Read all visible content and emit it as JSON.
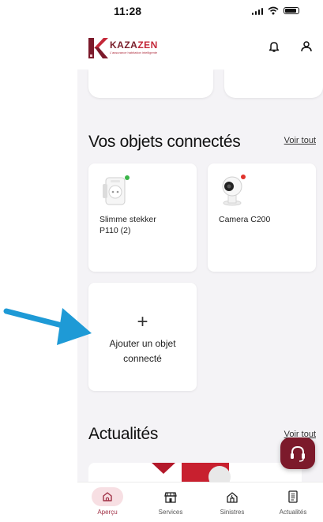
{
  "status": {
    "time": "11:28"
  },
  "brand": {
    "name_part1": "KAZA",
    "name_part2": "ZEN",
    "tagline": "L'assurance habitation intelligente",
    "accent": "#7c1a2b",
    "accent_light": "#c42839"
  },
  "header": {
    "icons": [
      "bell-icon",
      "user-icon"
    ]
  },
  "connected": {
    "title": "Vos objets connectés",
    "see_all": "Voir tout",
    "devices": [
      {
        "name_line1": "Slimme stekker",
        "name_line2": "P110 (2)",
        "status": "online",
        "status_color": "#3bb54a"
      },
      {
        "name_line1": "Camera C200",
        "status": "offline",
        "status_color": "#e0322c"
      }
    ],
    "add": {
      "line1": "Ajouter un objet",
      "line2": "connecté"
    }
  },
  "news": {
    "title": "Actualités",
    "see_all": "Voir tout"
  },
  "tabs": [
    {
      "label": "Aperçu",
      "icon": "home-icon",
      "active": true
    },
    {
      "label": "Services",
      "icon": "store-icon",
      "active": false
    },
    {
      "label": "Sinistres",
      "icon": "house-damage-icon",
      "active": false
    },
    {
      "label": "Actualités",
      "icon": "newspaper-icon",
      "active": false
    }
  ],
  "annotation": {
    "arrow_color": "#1e9ad6"
  }
}
